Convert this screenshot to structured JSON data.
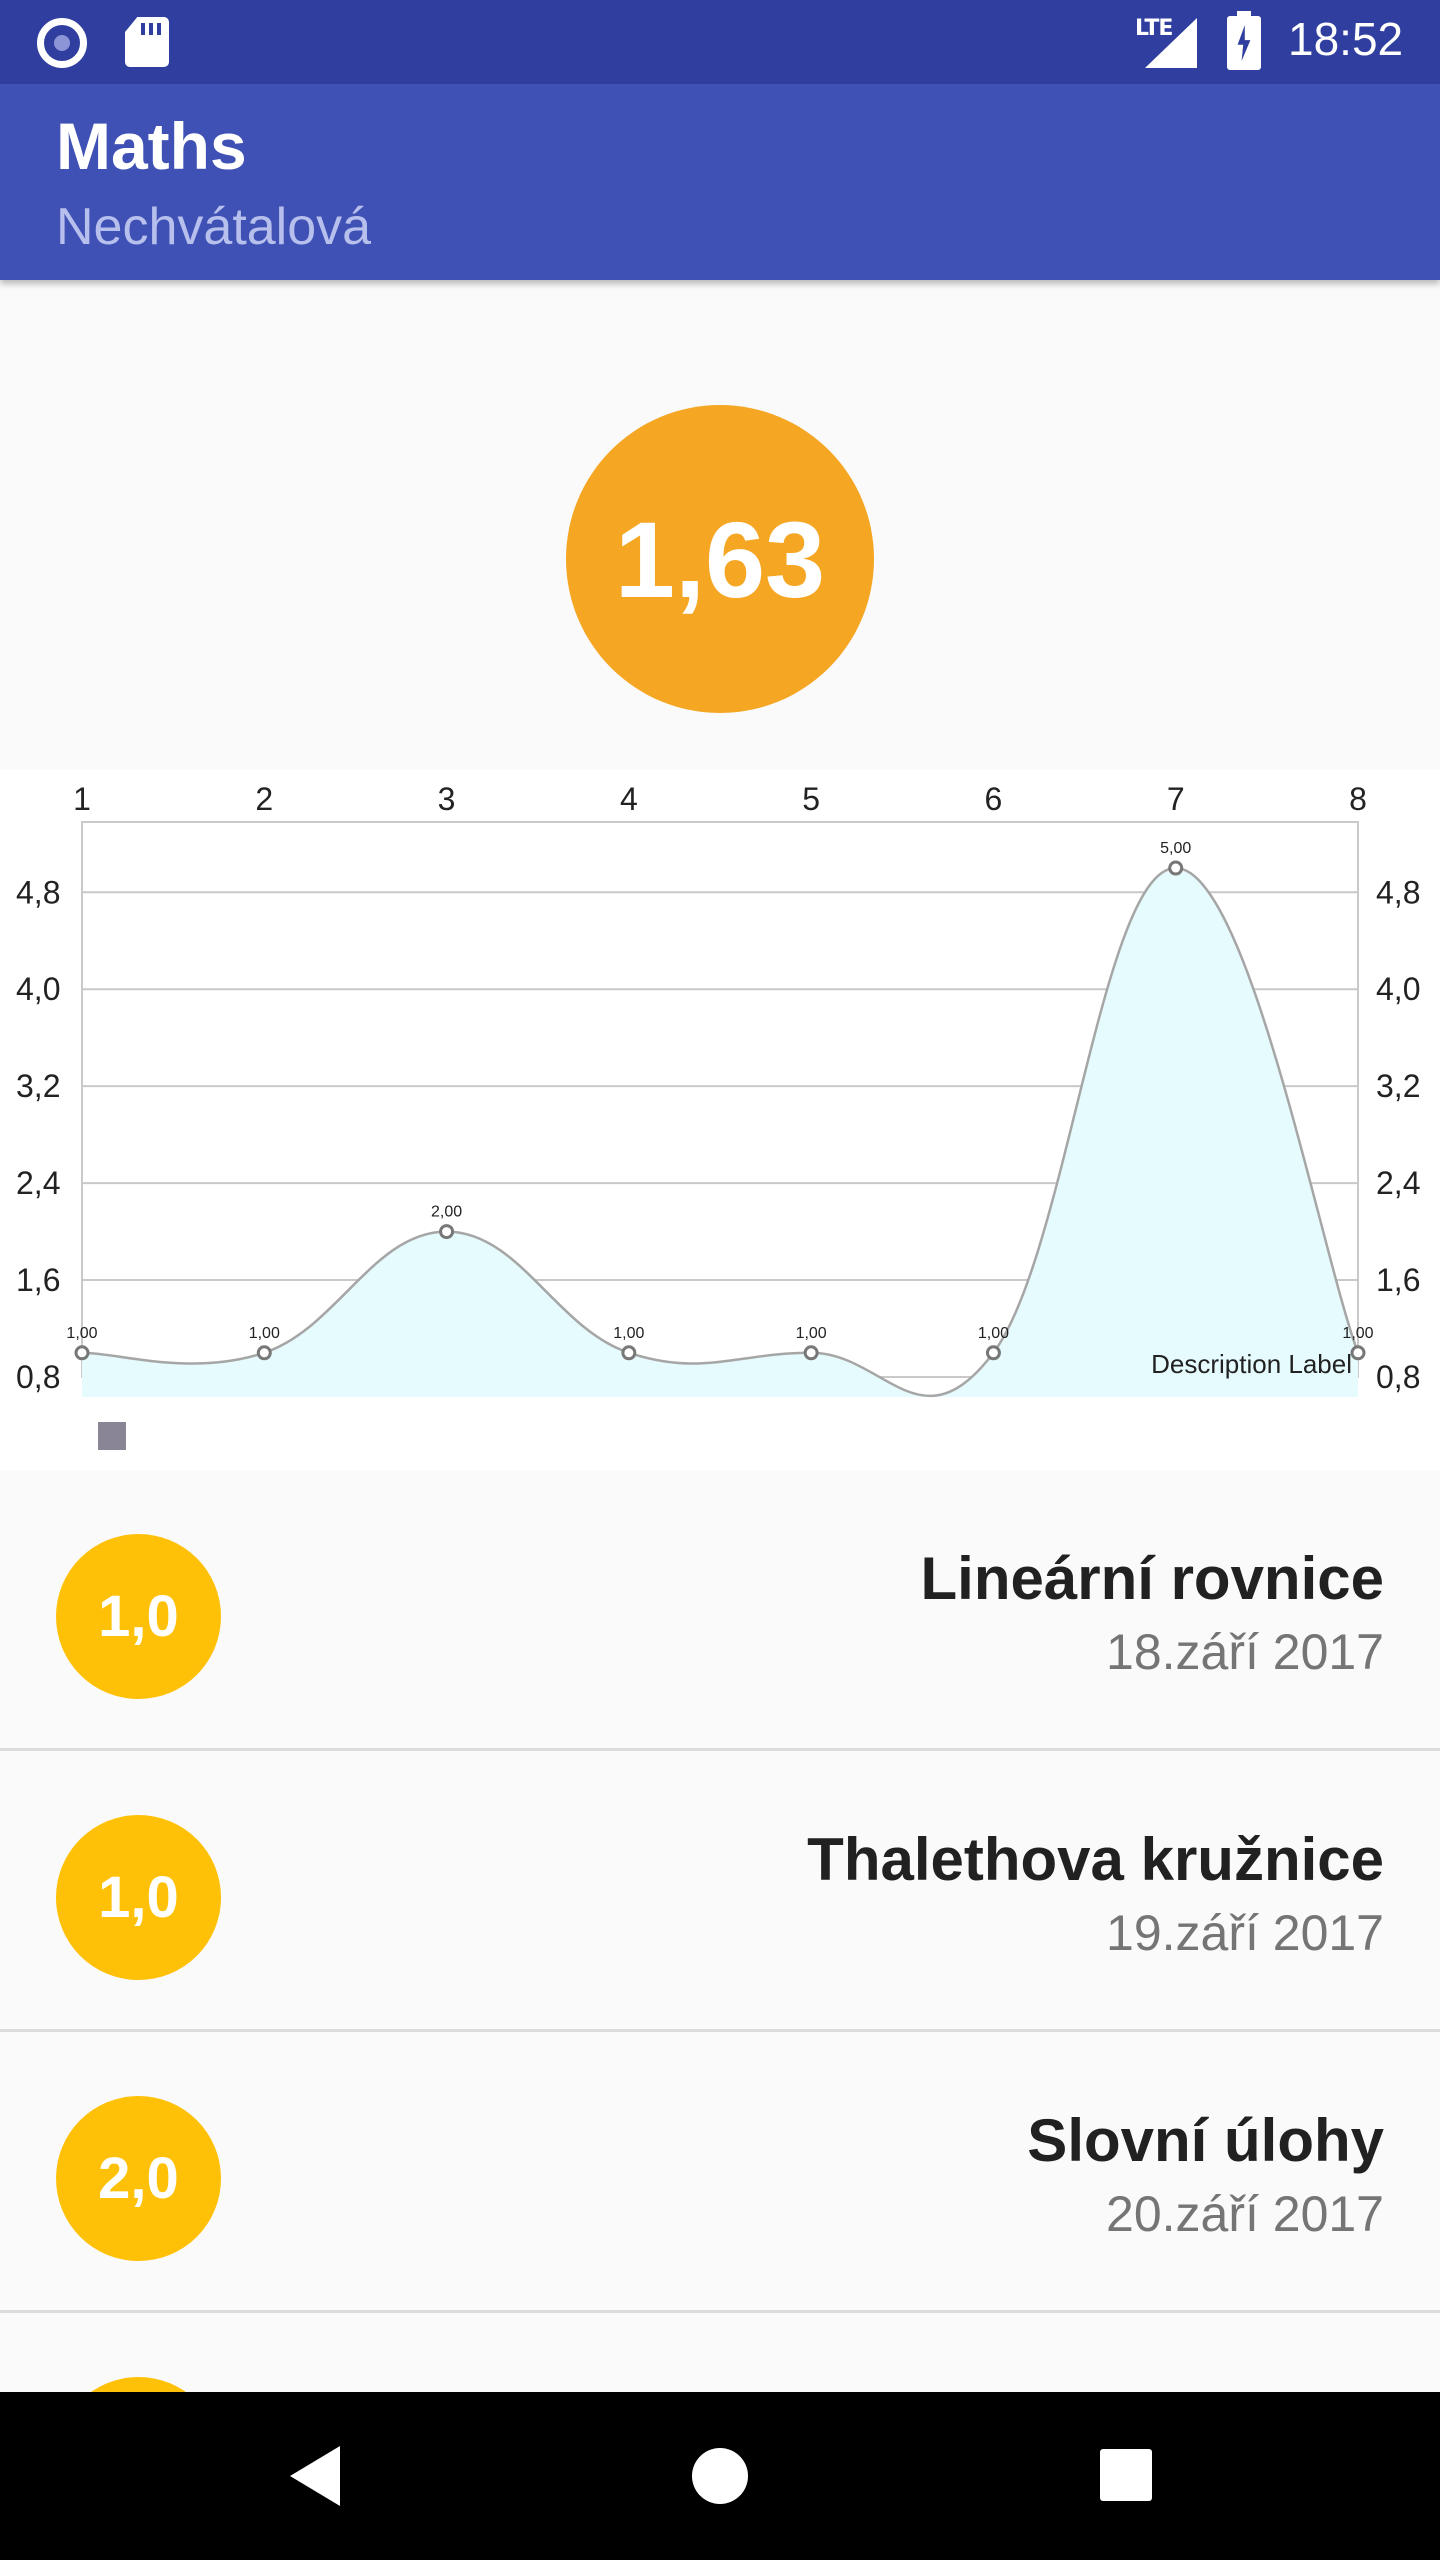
{
  "status_bar": {
    "network": "LTE",
    "time": "18:52"
  },
  "app_bar": {
    "title": "Maths",
    "subtitle": "Nechvátalová"
  },
  "average": {
    "value": "1,63",
    "color": "#f5a623"
  },
  "chart_data": {
    "type": "line",
    "x": [
      1,
      2,
      3,
      4,
      5,
      6,
      7,
      8
    ],
    "x_tick_labels": [
      "1",
      "2",
      "3",
      "4",
      "5",
      "6",
      "7",
      "8"
    ],
    "series": [
      {
        "values": [
          1.0,
          1.0,
          2.0,
          1.0,
          1.0,
          1.0,
          5.0,
          1.0
        ],
        "value_labels": [
          "1,00",
          "1,00",
          "2,00",
          "1,00",
          "1,00",
          "1,00",
          "5,00",
          "1,00"
        ],
        "line_color": "#a6a6a6",
        "fill_color": "#e6fbfd"
      }
    ],
    "y_ticks": [
      0.8,
      1.6,
      2.4,
      3.2,
      4.0,
      4.8
    ],
    "y_tick_labels": [
      "0,8",
      "1,6",
      "2,4",
      "3,2",
      "4,0",
      "4,8"
    ],
    "ylim": [
      0.8,
      5.38
    ],
    "xlim": [
      1,
      8
    ],
    "x_axis_position": "top",
    "y_axis_both_sides": true,
    "grid": "horizontal",
    "smooth": true,
    "description": "Description Label",
    "legend": "bottom-left"
  },
  "grades": [
    {
      "grade": "1,0",
      "title": "Lineární rovnice",
      "date": "18.září 2017"
    },
    {
      "grade": "1,0",
      "title": "Thalethova kružnice",
      "date": "19.září 2017"
    },
    {
      "grade": "2,0",
      "title": "Slovní úlohy",
      "date": "20.září 2017"
    },
    {
      "grade": "",
      "title": "",
      "date": ""
    }
  ],
  "colors": {
    "primary": "#3f51b5",
    "primary_dark": "#303f9f",
    "grade_circle": "#ffc107"
  }
}
